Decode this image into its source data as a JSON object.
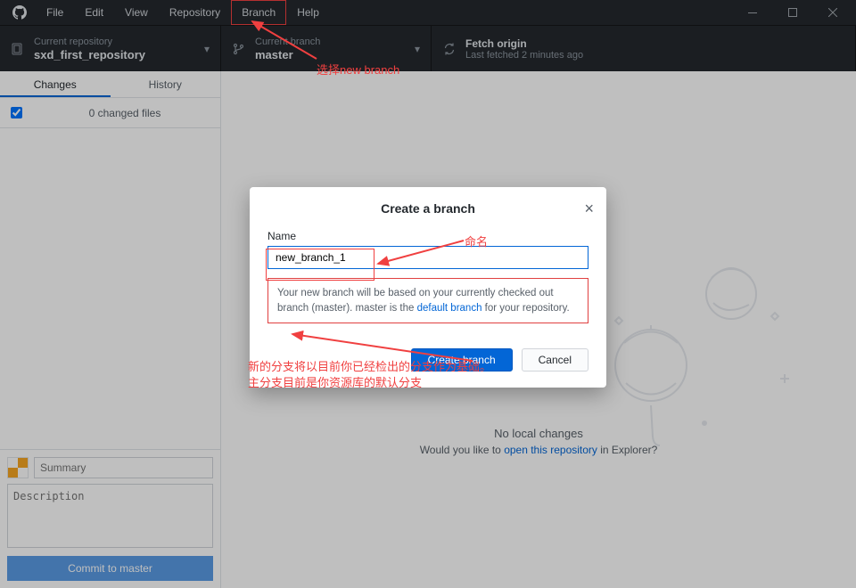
{
  "menu": {
    "file": "File",
    "edit": "Edit",
    "view": "View",
    "repository": "Repository",
    "branch": "Branch",
    "help": "Help"
  },
  "toolbar": {
    "repo": {
      "sub": "Current repository",
      "main": "sxd_first_repository"
    },
    "branch": {
      "sub": "Current branch",
      "main": "master"
    },
    "fetch": {
      "sub": "Fetch origin",
      "main": "Last fetched 2 minutes ago"
    }
  },
  "sidebar": {
    "tabs": {
      "changes": "Changes",
      "history": "History"
    },
    "changed_files": "0 changed files",
    "summary_placeholder": "Summary",
    "description_placeholder": "Description",
    "commit_button": "Commit to master"
  },
  "empty": {
    "heading": "No local changes",
    "prefix": "Would you like to ",
    "link": "open this repository",
    "suffix": " in Explorer?"
  },
  "dialog": {
    "title": "Create a branch",
    "name_label": "Name",
    "name_value": "new_branch_1",
    "info_p1": "Your new branch will be based on your currently checked out branch (master). master is the ",
    "info_link": "default branch",
    "info_p2": " for your repository.",
    "create": "Create branch",
    "cancel": "Cancel"
  },
  "annotations": {
    "select_branch": "选择new branch",
    "naming": "命名",
    "desc_line1": "新的分支将以目前你已经检出的分支作为基础。",
    "desc_line2": "主分支目前是你资源库的默认分支"
  }
}
